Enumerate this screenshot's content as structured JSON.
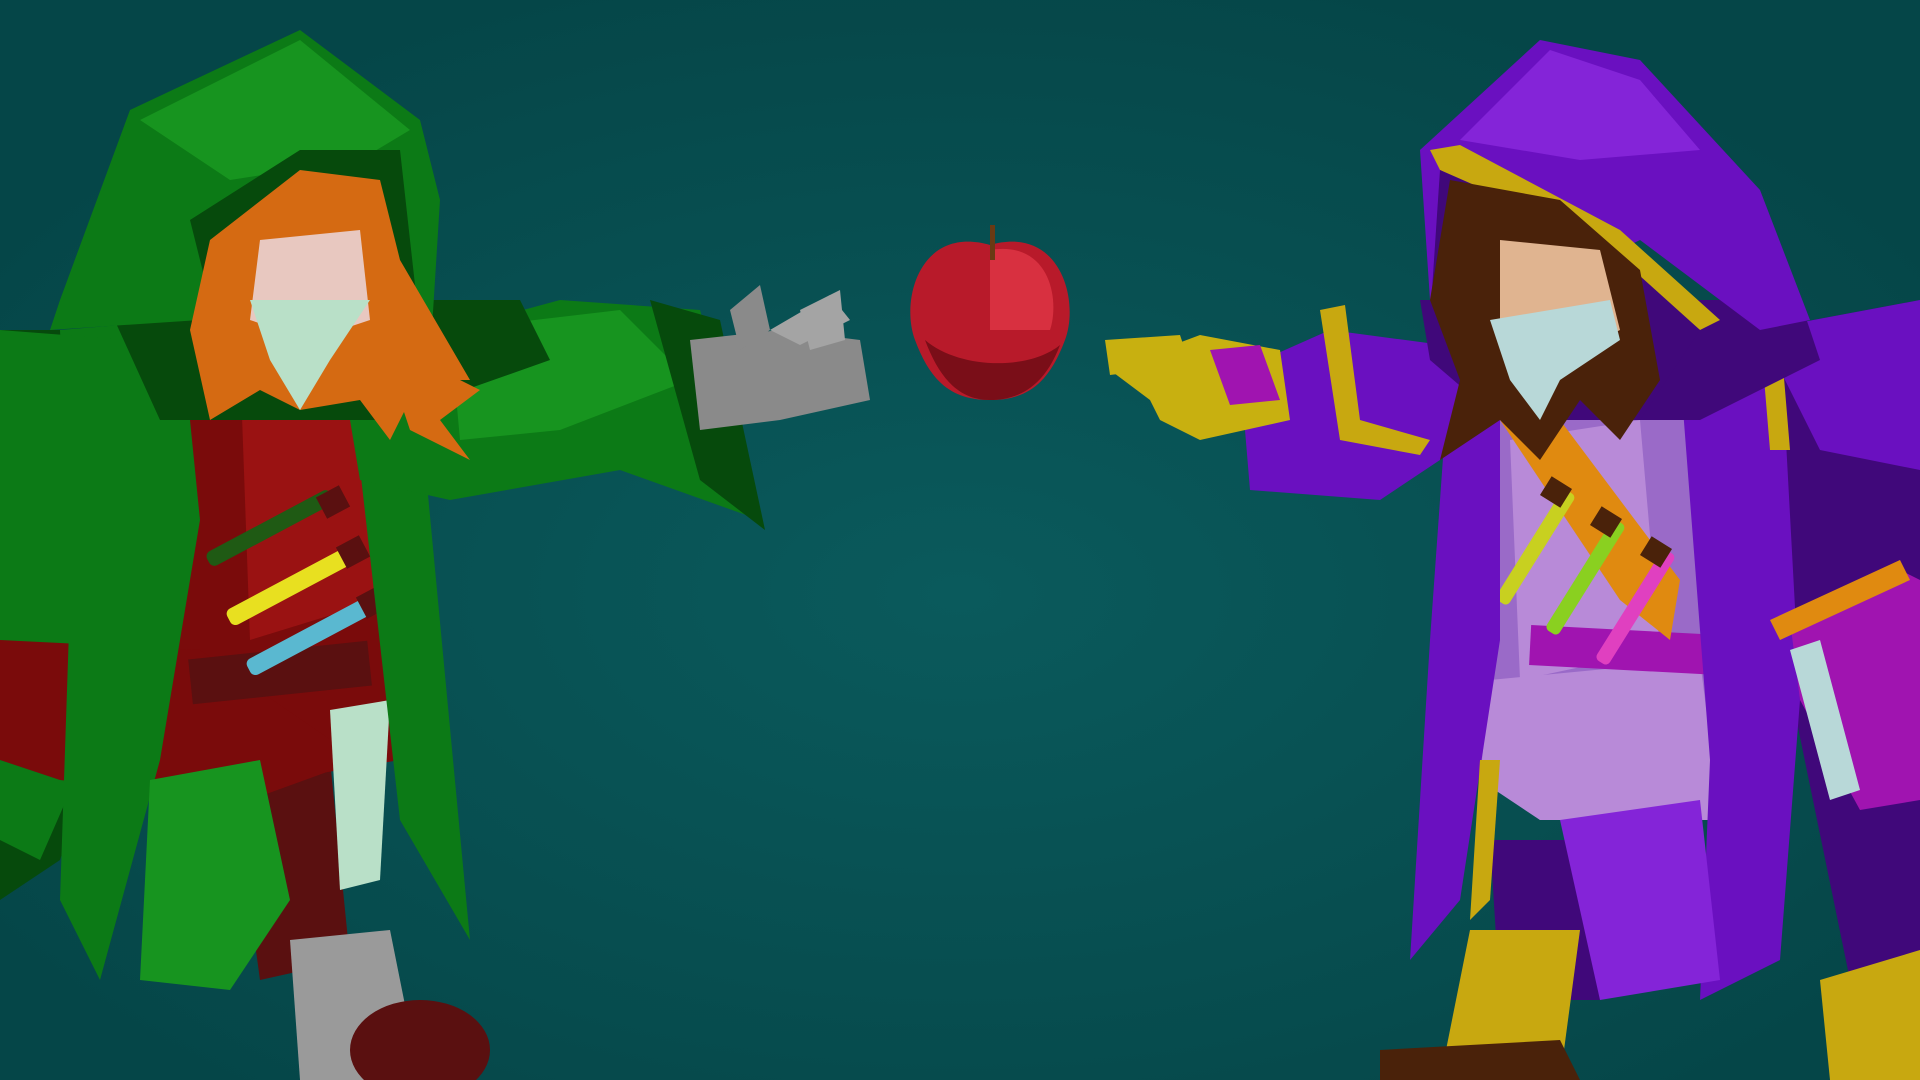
{
  "scene": {
    "background": "#064e50",
    "background_glow": "#0a5a5c",
    "characters": [
      {
        "id": "green-ranger",
        "side": "left",
        "colors": {
          "cloak": "#0c7a16",
          "cloak_light": "#17941f",
          "cloak_dark": "#064a0c",
          "tunic": "#7a0b0b",
          "tunic_light": "#9a1212",
          "hair": "#d56a12",
          "skin": "#e8c8c0",
          "mask": "#b9e0c8",
          "glove": "#8a8a8a",
          "glove_light": "#a4a4a4",
          "boot": "#9a9a9a",
          "belt": "#5a1010"
        },
        "potions": [
          "#1f5a14",
          "#e8e020",
          "#5ab8d0"
        ]
      },
      {
        "id": "purple-mage",
        "side": "right",
        "colors": {
          "cloak": "#6a10c0",
          "cloak_light": "#8424d8",
          "cloak_dark": "#40087a",
          "trim": "#c8a810",
          "tunic": "#9a6ac8",
          "tunic_light": "#b88ad8",
          "hair": "#4a220a",
          "skin": "#e0b490",
          "mask": "#b8d8d8",
          "glove": "#c8b010",
          "boot": "#c8a810",
          "sash": "#e08a10",
          "book": "#a014b0"
        },
        "potions": [
          "#c8d020",
          "#8ad020",
          "#e040c0"
        ]
      }
    ],
    "prop": {
      "name": "apple",
      "color": "#b81a2a",
      "highlight": "#d83040",
      "shadow": "#7a0e18",
      "stem": "#6a3a14"
    }
  }
}
